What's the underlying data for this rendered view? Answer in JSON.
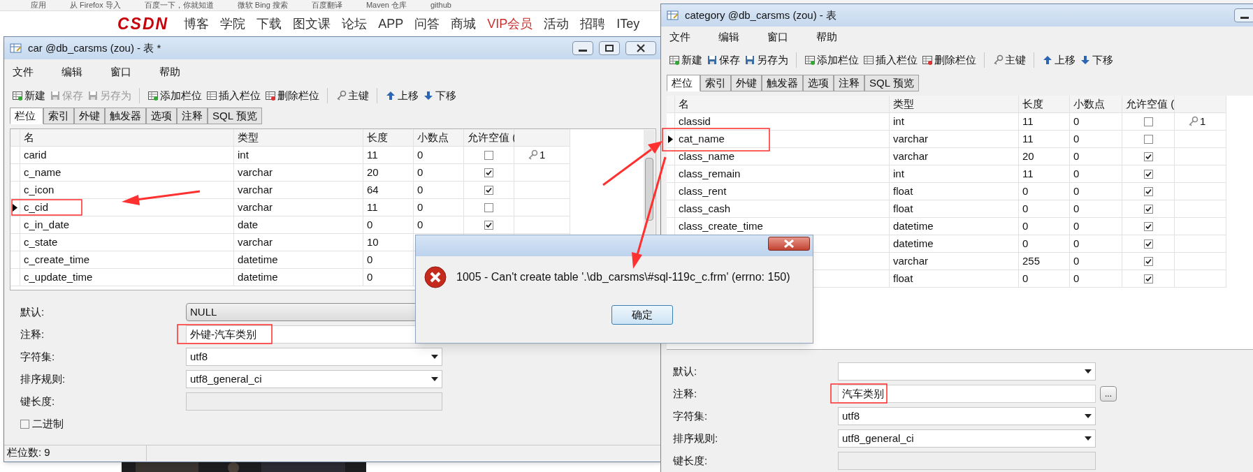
{
  "browser": {
    "bookmarks": [
      "应用",
      "从 Firefox 导入",
      "百度一下，你就知道",
      "微软 Bing 搜索",
      "百度翻译",
      "Maven 仓库",
      "github"
    ],
    "logo": "CSDN",
    "nav": [
      {
        "label": "博客",
        "highlight": false
      },
      {
        "label": "学院",
        "highlight": false
      },
      {
        "label": "下载",
        "highlight": false
      },
      {
        "label": "图文课",
        "highlight": false
      },
      {
        "label": "论坛",
        "highlight": false
      },
      {
        "label": "APP",
        "highlight": false
      },
      {
        "label": "问答",
        "highlight": false
      },
      {
        "label": "商城",
        "highlight": false
      },
      {
        "label": "VIP会员",
        "highlight": true
      },
      {
        "label": "活动",
        "highlight": false
      },
      {
        "label": "招聘",
        "highlight": false
      },
      {
        "label": "ITey",
        "highlight": false
      }
    ]
  },
  "windows": [
    {
      "title": "car @db_carsms (zou) - 表 *",
      "menu": [
        "文件",
        "编辑",
        "窗口",
        "帮助"
      ],
      "toolbar": [
        {
          "label": "新建",
          "kind": "new",
          "disabled": false
        },
        {
          "label": "保存",
          "kind": "save",
          "disabled": true
        },
        {
          "label": "另存为",
          "kind": "saveas",
          "disabled": true
        },
        {
          "label": "添加栏位",
          "kind": "add",
          "disabled": false
        },
        {
          "label": "插入栏位",
          "kind": "insert",
          "disabled": false
        },
        {
          "label": "删除栏位",
          "kind": "delete",
          "disabled": false
        },
        {
          "label": "主键",
          "kind": "key",
          "disabled": false
        },
        {
          "label": "上移",
          "kind": "up",
          "disabled": false
        },
        {
          "label": "下移",
          "kind": "down",
          "disabled": false
        }
      ],
      "tabs": [
        {
          "label": "栏位",
          "selected": true
        },
        {
          "label": "索引",
          "selected": false
        },
        {
          "label": "外键",
          "selected": false
        },
        {
          "label": "触发器",
          "selected": false
        },
        {
          "label": "选项",
          "selected": false
        },
        {
          "label": "注释",
          "selected": false
        },
        {
          "label": "SQL 预览",
          "selected": false
        }
      ],
      "columns": [
        "名",
        "类型",
        "长度",
        "小数点",
        "允许空值 ("
      ],
      "rows": [
        {
          "name": "carid",
          "type": "int",
          "length": "11",
          "decimal": "0",
          "nullable": false,
          "key": "1",
          "selected": false
        },
        {
          "name": "c_name",
          "type": "varchar",
          "length": "20",
          "decimal": "0",
          "nullable": true,
          "selected": false
        },
        {
          "name": "c_icon",
          "type": "varchar",
          "length": "64",
          "decimal": "0",
          "nullable": true,
          "selected": false
        },
        {
          "name": "c_cid",
          "type": "varchar",
          "length": "11",
          "decimal": "0",
          "nullable": false,
          "selected": true
        },
        {
          "name": "c_in_date",
          "type": "date",
          "length": "0",
          "decimal": "0",
          "nullable": true,
          "selected": false
        },
        {
          "name": "c_state",
          "type": "varchar",
          "length": "10",
          "selected": false
        },
        {
          "name": "c_create_time",
          "type": "datetime",
          "length": "0",
          "selected": false
        },
        {
          "name": "c_update_time",
          "type": "datetime",
          "length": "0",
          "selected": false
        }
      ],
      "form": [
        {
          "label": "默认:",
          "kind": "combo",
          "value": "NULL"
        },
        {
          "label": "注释:",
          "kind": "text",
          "value": "外键-汽车类别"
        },
        {
          "label": "字符集:",
          "kind": "select",
          "value": "utf8"
        },
        {
          "label": "排序规则:",
          "kind": "select",
          "value": "utf8_general_ci"
        },
        {
          "label": "键长度:",
          "kind": "disabled"
        }
      ],
      "binary": {
        "label": "二进制",
        "checked": false
      },
      "status": "栏位数: 9"
    },
    {
      "title": "category @db_carsms (zou) - 表",
      "menu": [
        "文件",
        "编辑",
        "窗口",
        "帮助"
      ],
      "toolbar": [
        {
          "label": "新建",
          "kind": "new",
          "disabled": false
        },
        {
          "label": "保存",
          "kind": "save",
          "disabled": false
        },
        {
          "label": "另存为",
          "kind": "saveas",
          "disabled": false
        },
        {
          "label": "添加栏位",
          "kind": "add",
          "disabled": false
        },
        {
          "label": "插入栏位",
          "kind": "insert",
          "disabled": false
        },
        {
          "label": "删除栏位",
          "kind": "delete",
          "disabled": false
        },
        {
          "label": "主键",
          "kind": "key",
          "disabled": false
        },
        {
          "label": "上移",
          "kind": "up",
          "disabled": false
        },
        {
          "label": "下移",
          "kind": "down",
          "disabled": false
        }
      ],
      "tabs": [
        {
          "label": "栏位",
          "selected": true
        },
        {
          "label": "索引",
          "selected": false
        },
        {
          "label": "外键",
          "selected": false
        },
        {
          "label": "触发器",
          "selected": false
        },
        {
          "label": "选项",
          "selected": false
        },
        {
          "label": "注释",
          "selected": false
        },
        {
          "label": "SQL 预览",
          "selected": false
        }
      ],
      "columns": [
        "名",
        "类型",
        "长度",
        "小数点",
        "允许空值 ("
      ],
      "rows": [
        {
          "name": "classid",
          "type": "int",
          "length": "11",
          "decimal": "0",
          "nullable": false,
          "key": "1",
          "selected": false
        },
        {
          "name": "cat_name",
          "type": "varchar",
          "length": "11",
          "decimal": "0",
          "nullable": false,
          "selected": true
        },
        {
          "name": "class_name",
          "type": "varchar",
          "length": "20",
          "decimal": "0",
          "nullable": true,
          "selected": false
        },
        {
          "name": "class_remain",
          "type": "int",
          "length": "11",
          "decimal": "0",
          "nullable": true,
          "selected": false
        },
        {
          "name": "class_rent",
          "type": "float",
          "length": "0",
          "decimal": "0",
          "nullable": true,
          "selected": false
        },
        {
          "name": "class_cash",
          "type": "float",
          "length": "0",
          "decimal": "0",
          "nullable": true,
          "selected": false
        },
        {
          "name": "class_create_time",
          "type": "datetime",
          "length": "0",
          "decimal": "0",
          "nullable": true,
          "selected": false
        },
        {
          "type": "datetime",
          "length": "0",
          "decimal": "0",
          "nullable": true
        },
        {
          "type": "varchar",
          "length": "255",
          "decimal": "0",
          "nullable": true
        },
        {
          "type": "float",
          "length": "0",
          "decimal": "0",
          "nullable": true
        }
      ],
      "form": [
        {
          "label": "默认:",
          "kind": "select"
        },
        {
          "label": "注释:",
          "kind": "text",
          "value": "汽车类别",
          "more": "..."
        },
        {
          "label": "字符集:",
          "kind": "select",
          "value": "utf8"
        },
        {
          "label": "排序规则:",
          "kind": "select",
          "value": "utf8_general_ci"
        },
        {
          "label": "键长度:",
          "kind": "disabled"
        }
      ]
    }
  ],
  "dialog": {
    "message": "1005 - Can't create table '.\\db_carsms\\#sql-119c_c.frm' (errno: 150)",
    "button": "确定"
  }
}
